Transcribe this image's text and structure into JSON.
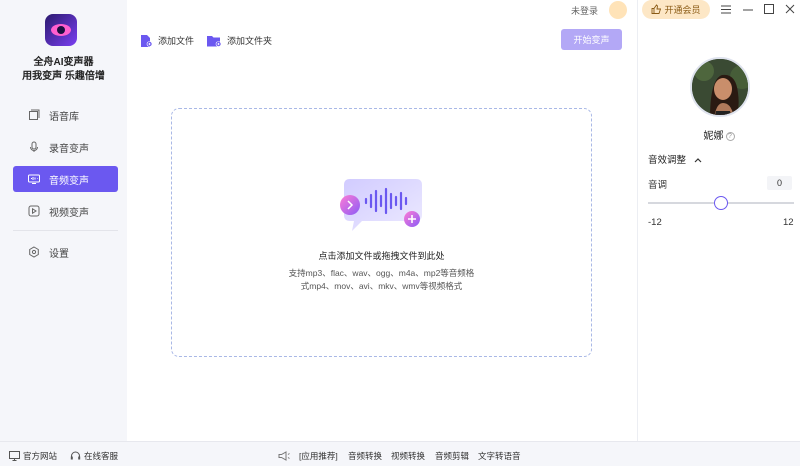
{
  "app": {
    "name": "全舟AI变声器",
    "slogan": "用我变声 乐趣倍增"
  },
  "nav": [
    {
      "label": "语音库",
      "icon": "cube-icon",
      "active": false
    },
    {
      "label": "录音变声",
      "icon": "microphone-icon",
      "active": false
    },
    {
      "label": "音频变声",
      "icon": "audio-screen-icon",
      "active": true
    },
    {
      "label": "视频变声",
      "icon": "play-icon",
      "active": false
    },
    {
      "label": "设置",
      "icon": "gear-icon",
      "active": false
    }
  ],
  "toolbar": {
    "add_file": "添加文件",
    "add_folder": "添加文件夹",
    "start": "开始变声"
  },
  "dropzone": {
    "title": "点击添加文件或拖拽文件到此处",
    "desc_line1": "支持mp3、flac、wav、ogg、m4a、mp2等音频格",
    "desc_line2": "式mp4、mov、avi、mkv、wmv等视频格式"
  },
  "topbar": {
    "login": "未登录",
    "vip": "开通会员"
  },
  "voice": {
    "name": "妮娜",
    "help": "?"
  },
  "effects": {
    "title": "音效调整",
    "pitch_label": "音调",
    "pitch_value": "0",
    "pitch_level_fraction": 0.5,
    "min": "-12",
    "max": "12"
  },
  "footer": {
    "website": "官方网站",
    "service": "在线客服",
    "recommend": "[应用推荐]",
    "links": [
      "音频转换",
      "视频转换",
      "音频剪辑",
      "文字转语音"
    ]
  },
  "colors": {
    "accent": "#6b58f0",
    "start_disabled": "#b3a8f6",
    "vip_bg": "#fde7c6"
  }
}
